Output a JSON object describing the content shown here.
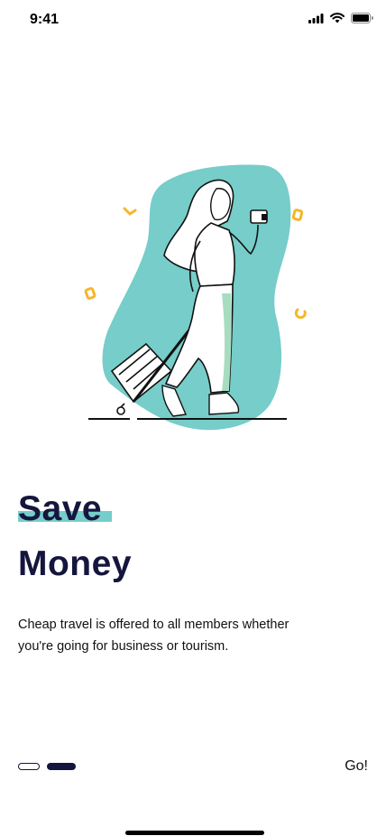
{
  "status_bar": {
    "time": "9:41"
  },
  "onboarding": {
    "title_line1": "Save",
    "title_line2": "Money",
    "description": "Cheap travel is offered to all members whether you're going for business or tourism.",
    "go_label": "Go!",
    "pager": {
      "total": 2,
      "active_index": 1
    }
  },
  "colors": {
    "accent": "#76cdc9",
    "dark": "#15163d",
    "confetti": "#f5b72a"
  }
}
